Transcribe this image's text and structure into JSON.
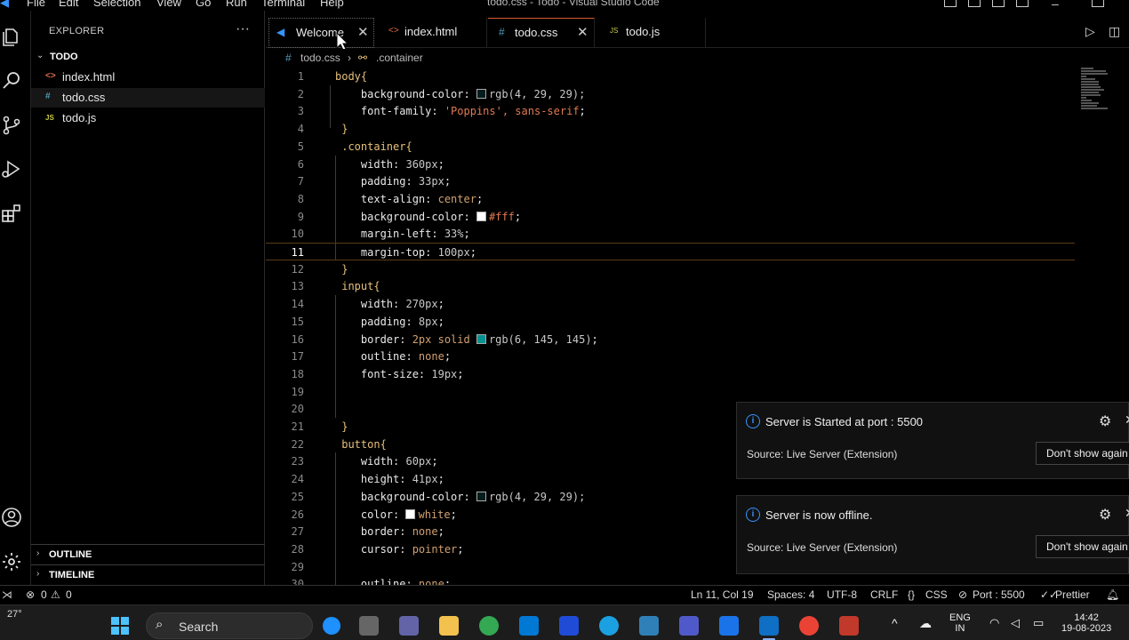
{
  "window": {
    "title": "todo.css - Todo - Visual Studio Code",
    "menu": [
      "File",
      "Edit",
      "Selection",
      "View",
      "Go",
      "Run",
      "Terminal",
      "Help"
    ]
  },
  "sidebar": {
    "title": "EXPLORER",
    "more": "···",
    "folder": "TODO",
    "files": [
      {
        "name": "index.html",
        "icon": "<>"
      },
      {
        "name": "todo.css",
        "icon": "#"
      },
      {
        "name": "todo.js",
        "icon": "JS"
      }
    ],
    "outline": "OUTLINE",
    "timeline": "TIMELINE"
  },
  "tabs": [
    {
      "label": "Welcome",
      "close": "✕"
    },
    {
      "label": "index.html",
      "icon": "<>"
    },
    {
      "label": "todo.css",
      "icon": "#",
      "close": "✕"
    },
    {
      "label": "todo.js",
      "icon": "JS"
    }
  ],
  "breadcrumb": {
    "file": "todo.css",
    "symbol": ".container",
    "file_icon": "#",
    "sep": "›"
  },
  "editor": {
    "current_line": 11,
    "lines": [
      {
        "n": "1",
        "tokens": [
          {
            "t": "body{",
            "c": "tok-sel"
          }
        ]
      },
      {
        "n": "2",
        "tokens": [
          {
            "t": "    background-color: ",
            "c": "tok-prop"
          },
          {
            "sw": "#04"
          },
          {
            "t": "rgb(4, 29, 29);",
            "c": "tok-num"
          }
        ]
      },
      {
        "n": "3",
        "tokens": [
          {
            "t": "    font-family: ",
            "c": "tok-prop"
          },
          {
            "t": "'Poppins', sans-serif",
            "c": "tok-str"
          },
          {
            "t": ";",
            "c": "tok-prop"
          }
        ]
      },
      {
        "n": "4",
        "tokens": [
          {
            "t": " }",
            "c": "tok-brace"
          }
        ]
      },
      {
        "n": "5",
        "tokens": [
          {
            "t": " .container{",
            "c": "tok-sel"
          }
        ]
      },
      {
        "n": "6",
        "tokens": [
          {
            "t": "    width: ",
            "c": "tok-prop"
          },
          {
            "t": "360px",
            "c": "tok-num"
          },
          {
            "t": ";",
            "c": "tok-prop"
          }
        ]
      },
      {
        "n": "7",
        "tokens": [
          {
            "t": "    padding: ",
            "c": "tok-prop"
          },
          {
            "t": "33px",
            "c": "tok-num"
          },
          {
            "t": ";",
            "c": "tok-prop"
          }
        ]
      },
      {
        "n": "8",
        "tokens": [
          {
            "t": "    text-align: ",
            "c": "tok-prop"
          },
          {
            "t": "center",
            "c": "tok-kw"
          },
          {
            "t": ";",
            "c": "tok-prop"
          }
        ]
      },
      {
        "n": "9",
        "tokens": [
          {
            "t": "    background-color: ",
            "c": "tok-prop"
          },
          {
            "sw": "#fff"
          },
          {
            "t": "#fff",
            "c": "tok-str"
          },
          {
            "t": ";",
            "c": "tok-prop"
          }
        ]
      },
      {
        "n": "10",
        "tokens": [
          {
            "t": "    margin-left: ",
            "c": "tok-prop"
          },
          {
            "t": "33%",
            "c": "tok-num"
          },
          {
            "t": ";",
            "c": "tok-prop"
          }
        ]
      },
      {
        "n": "11",
        "tokens": [
          {
            "t": "    margin-top: ",
            "c": "tok-prop"
          },
          {
            "t": "100px",
            "c": "tok-num"
          },
          {
            "t": ";",
            "c": "tok-prop"
          }
        ]
      },
      {
        "n": "12",
        "tokens": [
          {
            "t": " }",
            "c": "tok-brace"
          }
        ]
      },
      {
        "n": "13",
        "tokens": [
          {
            "t": " input{",
            "c": "tok-sel"
          }
        ]
      },
      {
        "n": "14",
        "tokens": [
          {
            "t": "    width: ",
            "c": "tok-prop"
          },
          {
            "t": "270px",
            "c": "tok-num"
          },
          {
            "t": ";",
            "c": "tok-prop"
          }
        ]
      },
      {
        "n": "15",
        "tokens": [
          {
            "t": "    padding: ",
            "c": "tok-prop"
          },
          {
            "t": "8px",
            "c": "tok-num"
          },
          {
            "t": ";",
            "c": "tok-prop"
          }
        ]
      },
      {
        "n": "16",
        "tokens": [
          {
            "t": "    border: ",
            "c": "tok-prop"
          },
          {
            "t": "2px solid ",
            "c": "tok-kw"
          },
          {
            "sw": "#069191"
          },
          {
            "t": "rgb(6, 145, 145)",
            "c": "tok-num"
          },
          {
            "t": ";",
            "c": "tok-prop"
          }
        ]
      },
      {
        "n": "17",
        "tokens": [
          {
            "t": "    outline: ",
            "c": "tok-prop"
          },
          {
            "t": "none",
            "c": "tok-kw"
          },
          {
            "t": ";",
            "c": "tok-prop"
          }
        ]
      },
      {
        "n": "18",
        "tokens": [
          {
            "t": "    font-size: ",
            "c": "tok-prop"
          },
          {
            "t": "19px",
            "c": "tok-num"
          },
          {
            "t": ";",
            "c": "tok-prop"
          }
        ]
      },
      {
        "n": "19",
        "tokens": []
      },
      {
        "n": "20",
        "tokens": []
      },
      {
        "n": "21",
        "tokens": [
          {
            "t": " }",
            "c": "tok-brace"
          }
        ]
      },
      {
        "n": "22",
        "tokens": [
          {
            "t": " button{",
            "c": "tok-sel"
          }
        ]
      },
      {
        "n": "23",
        "tokens": [
          {
            "t": "    width: ",
            "c": "tok-prop"
          },
          {
            "t": "60px",
            "c": "tok-num"
          },
          {
            "t": ";",
            "c": "tok-prop"
          }
        ]
      },
      {
        "n": "24",
        "tokens": [
          {
            "t": "    height: ",
            "c": "tok-prop"
          },
          {
            "t": "41px",
            "c": "tok-num"
          },
          {
            "t": ";",
            "c": "tok-prop"
          }
        ]
      },
      {
        "n": "25",
        "tokens": [
          {
            "t": "    background-color: ",
            "c": "tok-prop"
          },
          {
            "sw": "#04"
          },
          {
            "t": "rgb(4, 29, 29);",
            "c": "tok-num"
          }
        ]
      },
      {
        "n": "26",
        "tokens": [
          {
            "t": "    color: ",
            "c": "tok-prop"
          },
          {
            "sw": "#fff"
          },
          {
            "t": "white",
            "c": "tok-kw"
          },
          {
            "t": ";",
            "c": "tok-prop"
          }
        ]
      },
      {
        "n": "27",
        "tokens": [
          {
            "t": "    border: ",
            "c": "tok-prop"
          },
          {
            "t": "none",
            "c": "tok-kw"
          },
          {
            "t": ";",
            "c": "tok-prop"
          }
        ]
      },
      {
        "n": "28",
        "tokens": [
          {
            "t": "    cursor: ",
            "c": "tok-prop"
          },
          {
            "t": "pointer",
            "c": "tok-kw"
          },
          {
            "t": ";",
            "c": "tok-prop"
          }
        ]
      },
      {
        "n": "29",
        "tokens": []
      },
      {
        "n": "30",
        "tokens": [
          {
            "t": "    outline: ",
            "c": "tok-prop"
          },
          {
            "t": "none",
            "c": "tok-kw"
          },
          {
            "t": ";",
            "c": "tok-prop"
          }
        ]
      }
    ]
  },
  "notifications": [
    {
      "message": "Server is Started at port : 5500",
      "source": "Source: Live Server (Extension)",
      "action": "Don't show again"
    },
    {
      "message": "Server is now offline.",
      "source": "Source: Live Server (Extension)",
      "action": "Don't show again"
    }
  ],
  "statusbar": {
    "errors": "0",
    "warnings": "0",
    "position": "Ln 11, Col 19",
    "spaces": "Spaces: 4",
    "encoding": "UTF-8",
    "eol": "CRLF",
    "language": "CSS",
    "port": "Port : 5500",
    "formatter": "Prettier"
  },
  "taskbar": {
    "temperature": "27°",
    "search": "Search",
    "lang1": "ENG",
    "lang2": "IN",
    "time": "14:42",
    "date": "19-08-2023"
  },
  "colors": {
    "accent_blue": "#3794ff",
    "active_tab_border": "#d85a2a",
    "selector": "#e6c07b",
    "string": "#e07a50"
  }
}
